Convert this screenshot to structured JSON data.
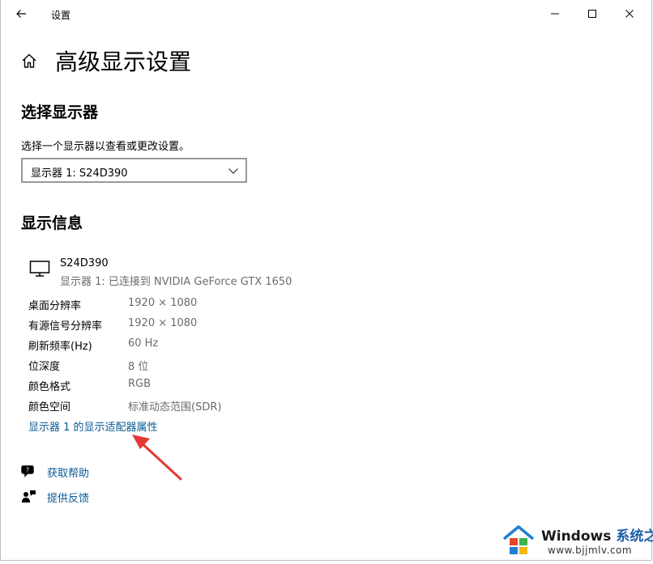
{
  "window": {
    "title": "设置",
    "controls": {
      "minimize": "minimize-icon",
      "maximize": "maximize-icon",
      "close": "close-icon"
    }
  },
  "page": {
    "title": "高级显示设置"
  },
  "select_display": {
    "heading": "选择显示器",
    "hint": "选择一个显示器以查看或更改设置。",
    "selected": "显示器 1: S24D390"
  },
  "display_info": {
    "heading": "显示信息",
    "monitor_name": "S24D390",
    "monitor_connection": "显示器 1: 已连接到 NVIDIA GeForce GTX 1650",
    "rows": [
      {
        "label": "桌面分辨率",
        "value": "1920 × 1080"
      },
      {
        "label": "有源信号分辨率",
        "value": "1920 × 1080"
      },
      {
        "label": "刷新频率(Hz)",
        "value": "60 Hz"
      },
      {
        "label": "位深度",
        "value": "8 位"
      },
      {
        "label": "颜色格式",
        "value": "RGB"
      },
      {
        "label": "颜色空间",
        "value": "标准动态范围(SDR)"
      }
    ],
    "adapter_link": "显示器 1 的显示适配器属性"
  },
  "footer_links": {
    "help": "获取帮助",
    "feedback": "提供反馈"
  },
  "colors": {
    "link": "#0a5a94",
    "annotation_arrow": "#e53935"
  },
  "watermark": {
    "brand_en": "Windows",
    "brand_cn": "系统之家",
    "url": "www.bjjmlv.com"
  }
}
